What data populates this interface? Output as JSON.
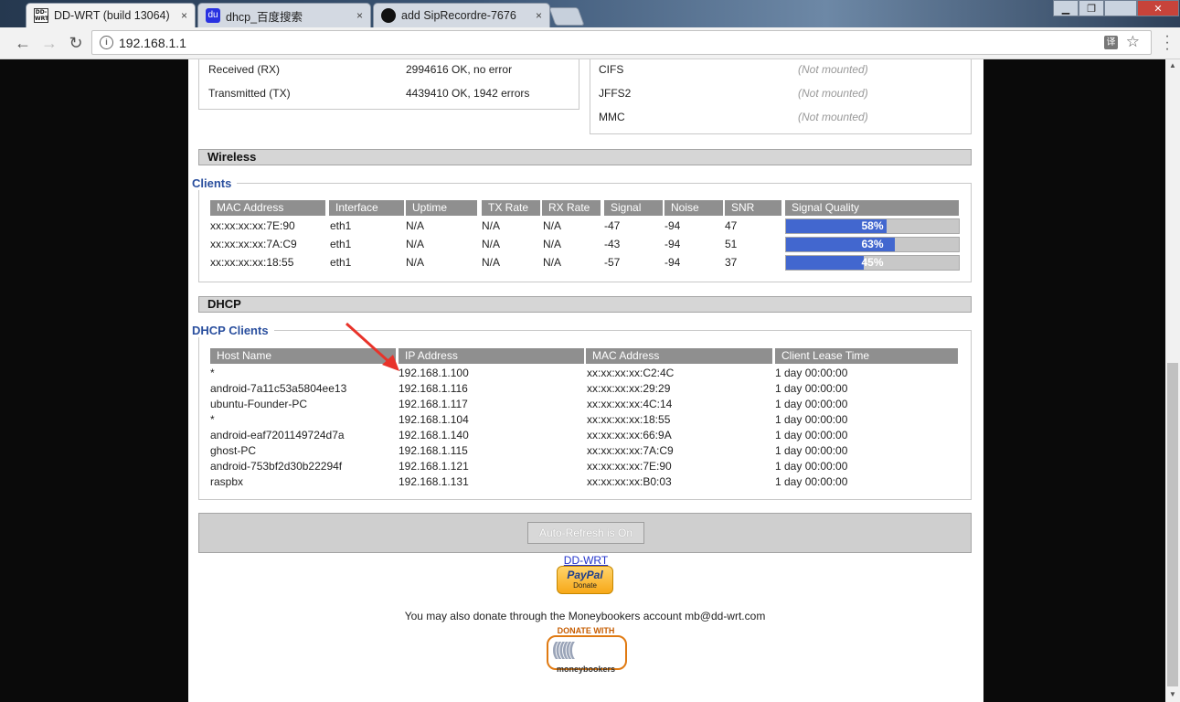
{
  "browser": {
    "tabs": [
      {
        "title": "DD-WRT (build 13064)",
        "favicon": "ddwrt-icon",
        "active": true
      },
      {
        "title": "dhcp_百度搜索",
        "favicon": "baidu-paw-icon",
        "active": false
      },
      {
        "title": "add SipRecordre-7676",
        "favicon": "github-icon",
        "active": false
      }
    ],
    "favicon_text": "DD-WRT",
    "baidu_glyph": "du",
    "url": "192.168.1.1",
    "translate_glyph": "译",
    "star_glyph": "☆",
    "back_glyph": "←",
    "forward_glyph": "→",
    "reload_glyph": "↻",
    "window_controls": [
      "▁",
      "❐",
      "✕"
    ],
    "close_tab_glyph": "×"
  },
  "network": {
    "rows": [
      {
        "label": "Received (RX)",
        "value": "2994616 OK, no error"
      },
      {
        "label": "Transmitted (TX)",
        "value": "4439410 OK, 1942 errors"
      }
    ]
  },
  "filesystems": {
    "rows": [
      {
        "label": "CIFS",
        "value": "(Not mounted)"
      },
      {
        "label": "JFFS2",
        "value": "(Not mounted)"
      },
      {
        "label": "MMC",
        "value": "(Not mounted)"
      }
    ]
  },
  "wireless": {
    "section_title": "Wireless",
    "clients_legend": "Clients",
    "headers": [
      "MAC Address",
      "Interface",
      "Uptime",
      "TX Rate",
      "RX Rate",
      "Signal",
      "Noise",
      "SNR",
      "Signal Quality"
    ],
    "rows": [
      {
        "mac": "xx:xx:xx:xx:7E:90",
        "iface": "eth1",
        "uptime": "N/A",
        "tx": "N/A",
        "rx": "N/A",
        "signal": "-47",
        "noise": "-94",
        "snr": "47",
        "quality_label": "58%",
        "quality": 0.58
      },
      {
        "mac": "xx:xx:xx:xx:7A:C9",
        "iface": "eth1",
        "uptime": "N/A",
        "tx": "N/A",
        "rx": "N/A",
        "signal": "-43",
        "noise": "-94",
        "snr": "51",
        "quality_label": "63%",
        "quality": 0.63
      },
      {
        "mac": "xx:xx:xx:xx:18:55",
        "iface": "eth1",
        "uptime": "N/A",
        "tx": "N/A",
        "rx": "N/A",
        "signal": "-57",
        "noise": "-94",
        "snr": "37",
        "quality_label": "45%",
        "quality": 0.45
      }
    ]
  },
  "dhcp": {
    "section_title": "DHCP",
    "clients_legend": "DHCP Clients",
    "headers": [
      "Host Name",
      "IP Address",
      "MAC Address",
      "Client Lease Time"
    ],
    "rows": [
      {
        "host": "*",
        "ip": "192.168.1.100",
        "mac": "xx:xx:xx:xx:C2:4C",
        "lease": "1 day 00:00:00"
      },
      {
        "host": "android-7a11c53a5804ee13",
        "ip": "192.168.1.116",
        "mac": "xx:xx:xx:xx:29:29",
        "lease": "1 day 00:00:00"
      },
      {
        "host": "ubuntu-Founder-PC",
        "ip": "192.168.1.117",
        "mac": "xx:xx:xx:xx:4C:14",
        "lease": "1 day 00:00:00"
      },
      {
        "host": "*",
        "ip": "192.168.1.104",
        "mac": "xx:xx:xx:xx:18:55",
        "lease": "1 day 00:00:00"
      },
      {
        "host": "android-eaf7201149724d7a",
        "ip": "192.168.1.140",
        "mac": "xx:xx:xx:xx:66:9A",
        "lease": "1 day 00:00:00"
      },
      {
        "host": "ghost-PC",
        "ip": "192.168.1.115",
        "mac": "xx:xx:xx:xx:7A:C9",
        "lease": "1 day 00:00:00"
      },
      {
        "host": "android-753bf2d30b22294f",
        "ip": "192.168.1.121",
        "mac": "xx:xx:xx:xx:7E:90",
        "lease": "1 day 00:00:00"
      },
      {
        "host": "raspbx",
        "ip": "192.168.1.131",
        "mac": "xx:xx:xx:xx:B0:03",
        "lease": "1 day 00:00:00"
      }
    ]
  },
  "footer": {
    "auto_refresh_label": "Auto-Refresh is On",
    "ddwrt_link": "DD-WRT",
    "paypal_brand": "PayPal",
    "paypal_donate": "Donate",
    "moneybookers_text": "You may also donate through the Moneybookers account mb@dd-wrt.com",
    "mb_top": "DONATE WITH",
    "mb_waves": "((((((",
    "mb_bottom": "moneybookers"
  },
  "colors": {
    "signal_bar": "#4267cf",
    "legend_text": "#2a4f9e",
    "annotation_arrow": "#e8332a"
  }
}
